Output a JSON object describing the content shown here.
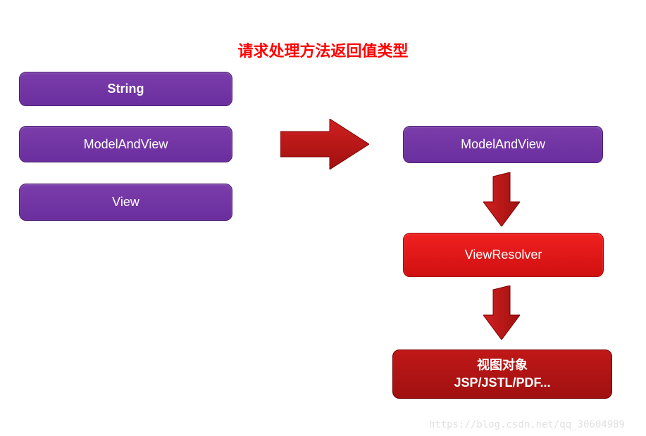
{
  "title": "请求处理方法返回值类型",
  "left_boxes": {
    "box1": "String",
    "box2": "ModelAndView",
    "box3": "View"
  },
  "right_boxes": {
    "model_and_view": "ModelAndView",
    "view_resolver": "ViewResolver",
    "view_object_line1": "视图对象",
    "view_object_line2": "JSP/JSTL/PDF..."
  },
  "colors": {
    "purple": "#6b2e9e",
    "red": "#e01010",
    "dark_red": "#b01414",
    "title_red": "#ff0000"
  },
  "watermark": "https://blog.csdn.net/qq_30604989"
}
